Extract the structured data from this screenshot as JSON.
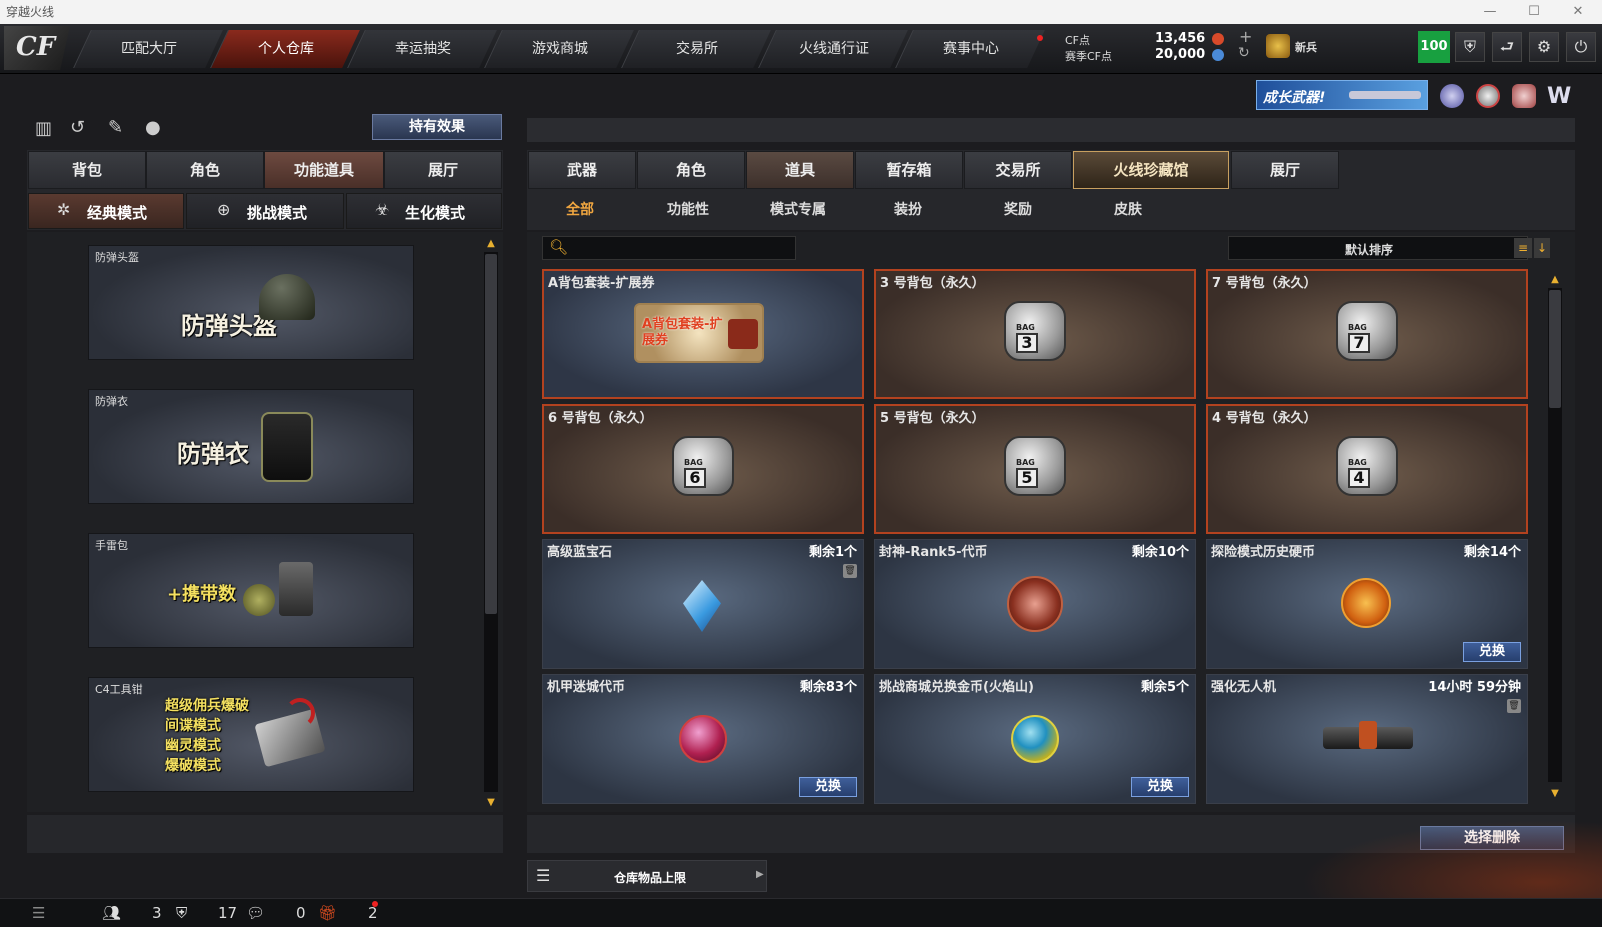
{
  "window": {
    "title": "穿越火线"
  },
  "logo": {
    "text": "CF"
  },
  "nav": {
    "tabs": [
      "匹配大厅",
      "个人仓库",
      "幸运抽奖",
      "游戏商城",
      "交易所",
      "火线通行证",
      "赛事中心"
    ],
    "active": "个人仓库"
  },
  "currency": {
    "cf_label": "CF点",
    "cf_value": "13,456",
    "event_label": "赛季CF点",
    "event_value": "20,000"
  },
  "rank": {
    "label": "新兵"
  },
  "level_badge": "100",
  "banner": {
    "text": "成长武器!"
  },
  "left": {
    "effect_button": "持有效果",
    "tabs": [
      "背包",
      "角色",
      "功能道具",
      "展厅"
    ],
    "active_tab": "功能道具",
    "modes": [
      "经典模式",
      "挑战模式",
      "生化模式"
    ],
    "cards": [
      {
        "label": "防弹头盔",
        "title": "防弹头盔"
      },
      {
        "label": "防弹衣",
        "title": "防弹衣"
      },
      {
        "label": "手雷包",
        "title": "+携带数"
      },
      {
        "label": "C4工具钳",
        "lines": [
          "超级佣兵爆破",
          "间谍模式",
          "幽灵模式",
          "爆破模式"
        ]
      }
    ]
  },
  "right": {
    "tabs": [
      "武器",
      "角色",
      "道具",
      "暂存箱",
      "交易所",
      "火线珍藏馆",
      "展厅"
    ],
    "active_tab": "火线珍藏馆",
    "subtabs": [
      "全部",
      "功能性",
      "模式专属",
      "装扮",
      "奖励",
      "皮肤"
    ],
    "active_subtab": "全部",
    "sort_label": "默认排序",
    "items": [
      {
        "name": "A背包套装-扩展券",
        "art": "A背包套装-扩展券"
      },
      {
        "name": "3 号背包（永久）",
        "bag": "3"
      },
      {
        "name": "7 号背包（永久）",
        "bag": "7"
      },
      {
        "name": "6 号背包（永久）",
        "bag": "6"
      },
      {
        "name": "5 号背包（永久）",
        "bag": "5"
      },
      {
        "name": "4 号背包（永久）",
        "bag": "4"
      },
      {
        "name": "高级蓝宝石",
        "remain": "剩余1个"
      },
      {
        "name": "封神-Rank5-代币",
        "remain": "剩余10个"
      },
      {
        "name": "探险模式历史硬币",
        "remain": "剩余14个",
        "button": "兑换"
      },
      {
        "name": "机甲迷城代币",
        "remain": "剩余83个",
        "button": "兑换"
      },
      {
        "name": "挑战商城兑换金币(火焰山)",
        "remain": "剩余5个",
        "button": "兑换"
      },
      {
        "name": "强化无人机",
        "remain": "14小时 59分钟"
      }
    ],
    "delete_button": "选择删除",
    "storage_label": "仓库物品上限"
  },
  "bottom": {
    "count1": "3",
    "count2": "17",
    "count3": "0",
    "count4": "2"
  },
  "colors": {
    "accent_red": "#b3421f",
    "gold": "#f0a640",
    "exchange_blue": "#3f5f9a"
  }
}
